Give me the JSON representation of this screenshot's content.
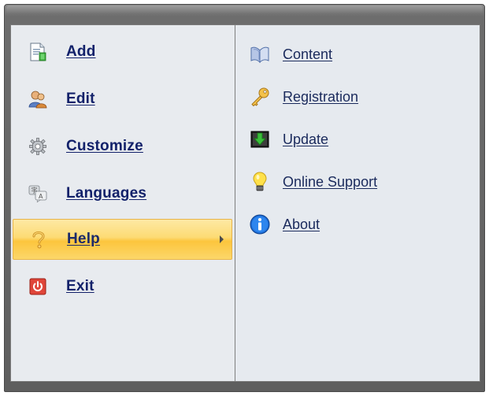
{
  "menu": {
    "left_items": [
      {
        "label": "Add",
        "icon": "document-add-icon"
      },
      {
        "label": "Edit",
        "icon": "users-edit-icon"
      },
      {
        "label": "Customize",
        "icon": "gear-icon"
      },
      {
        "label": "Languages",
        "icon": "languages-icon"
      },
      {
        "label": "Help",
        "icon": "question-icon",
        "active": true,
        "has_submenu": true
      },
      {
        "label": "Exit",
        "icon": "power-icon"
      }
    ],
    "right_items": [
      {
        "label": "Content",
        "icon": "book-icon"
      },
      {
        "label": "Registration",
        "icon": "key-icon"
      },
      {
        "label": "Update",
        "icon": "download-icon"
      },
      {
        "label": "Online Support",
        "icon": "lightbulb-icon"
      },
      {
        "label": "About",
        "icon": "info-icon"
      }
    ]
  },
  "colors": {
    "highlight": "#fcd76a",
    "left_label": "#12216a",
    "right_label": "#1a2a5c"
  }
}
